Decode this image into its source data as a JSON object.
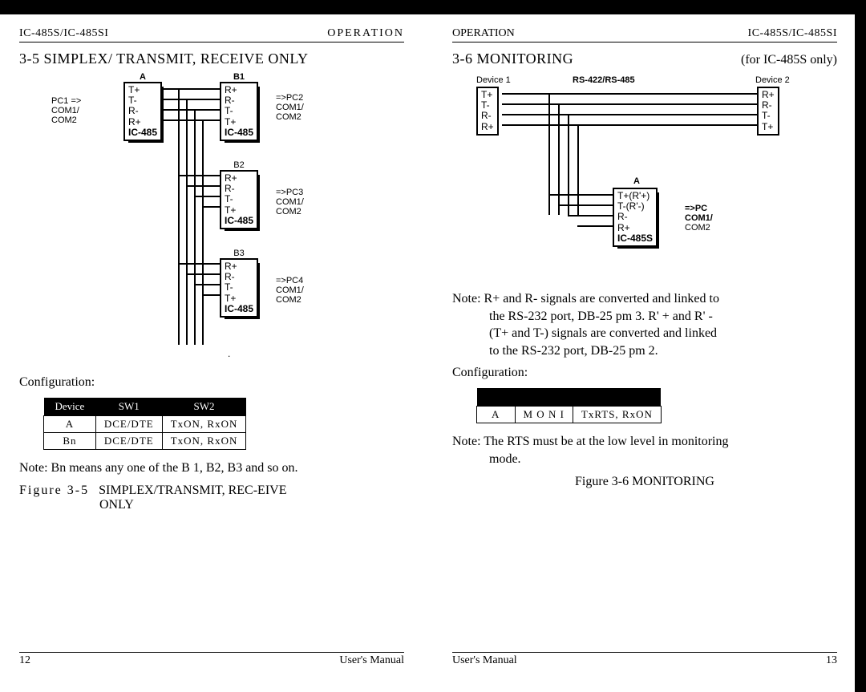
{
  "left": {
    "header_model": "IC-485S/IC-485SI",
    "header_op": "OPERATION",
    "title": "3-5  SIMPLEX/  TRANSMIT,  RECEIVE  ONLY",
    "diag": {
      "A": "A",
      "B1": "B1",
      "B2": "B2",
      "B3": "B3",
      "pins_a": [
        "T+",
        "T-",
        "R-",
        "R+"
      ],
      "pins_b": [
        "R+",
        "R-",
        "T-",
        "T+"
      ],
      "ic": "IC-485",
      "pc1": "PC1  =>",
      "com": "COM1/",
      "com2": "COM2",
      "pc2": "=>PC2",
      "pc3": "=>PC3",
      "pc4": "=>PC4"
    },
    "cfg_label": "Configuration:",
    "table": {
      "h1": "Device",
      "h2": "SW1",
      "h3": "SW2",
      "r1": [
        "A",
        "DCE/DTE",
        "TxON,  RxON"
      ],
      "r2": [
        "Bn",
        "DCE/DTE",
        "TxON,  RxON"
      ]
    },
    "note": "Note: Bn means any one of the B 1, B2, B3 and so on.",
    "fig_no": "Figure   3-5",
    "fig_txt1": "SIMPLEX/TRANSMIT,  REC-EIVE",
    "fig_txt2": "ONLY",
    "pg": "12",
    "manual": "User's  Manual"
  },
  "right": {
    "header_op": "OPERATION",
    "header_model": "IC-485S/IC-485SI",
    "title": "3-6  MONITORING",
    "subnote": "(for IC-485S only)",
    "diag": {
      "d1": "Device 1",
      "d2": "Device 2",
      "bus": "RS-422/RS-485",
      "pins_d": [
        "T+",
        "T-",
        "R-",
        "R+"
      ],
      "pins_b": [
        "R+",
        "R-",
        "T-",
        "T+"
      ],
      "A": "A",
      "pins_a": [
        "T+(R'+)",
        "T-(R'-)",
        "R-",
        "R+"
      ],
      "ic": "IC-485S",
      "pc": "=>PC",
      "com": "COM1/",
      "com2": "COM2"
    },
    "note1a": "Note: R+ and R- signals are converted and linked to",
    "note1b": "the RS-232 port, DB-25 pm 3. R' + and R' -",
    "note1c": "(T+ and T-) signals are converted and linked",
    "note1d": "to the RS-232 port, DB-25 pm 2.",
    "cfg_label": "Configuration:",
    "table": {
      "r1": [
        "A",
        "M  O  N  I",
        "TxRTS,  RxON"
      ]
    },
    "note2a": "Note: The RTS must be at the low level in monitoring",
    "note2b": "mode.",
    "fig": "Figure 3-6 MONITORING",
    "manual": "User's Manual",
    "pg": "13"
  }
}
